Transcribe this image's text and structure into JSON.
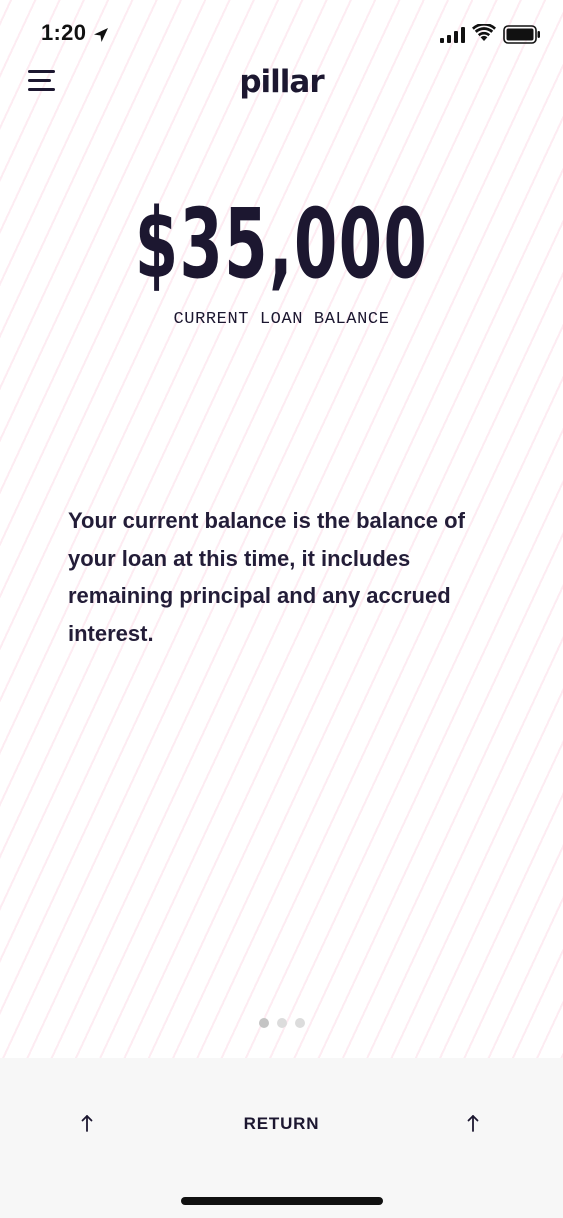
{
  "status_bar": {
    "time": "1:20",
    "icons": [
      "location-arrow-icon",
      "cellular-signal-icon",
      "wifi-icon",
      "battery-icon"
    ]
  },
  "header": {
    "menu_icon": "hamburger-menu-icon",
    "logo_text": "pillar"
  },
  "balance": {
    "amount": "$35,000",
    "caption": "CURRENT LOAN BALANCE"
  },
  "description": "Your current balance is the balance of your loan at this time, it includes remaining principal and any accrued interest.",
  "pagination": {
    "total": 3,
    "active_index": 0
  },
  "bottom_bar": {
    "return_label": "RETURN",
    "left_icon": "arrow-up-icon",
    "right_icon": "arrow-up-icon"
  },
  "colors": {
    "ink": "#1c1730",
    "pattern_accent": "#fcdce8",
    "bottom_bar_bg": "#f7f7f7",
    "dot_active": "#c4c4c4",
    "dot_inactive": "#dcdcdc"
  }
}
